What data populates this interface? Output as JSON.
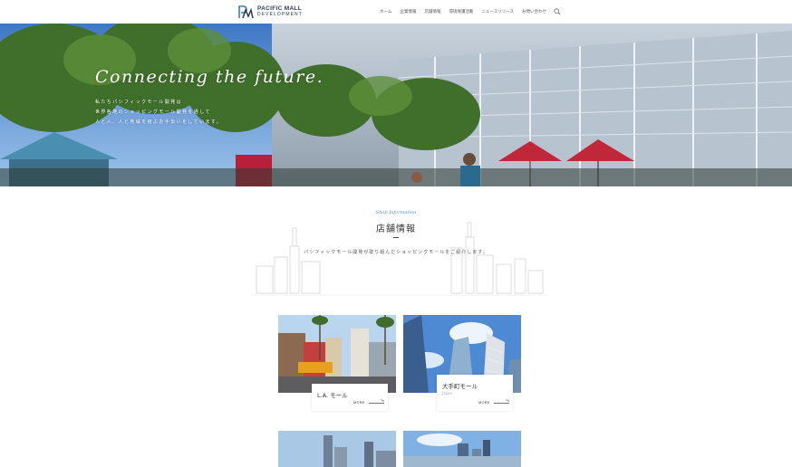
{
  "header": {
    "logo_line1": "PACIFIC MALL",
    "logo_line2": "DEVELOPMENT",
    "nav": [
      "ホーム",
      "企業情報",
      "店舗情報",
      "環境保護活動",
      "ニュースリリース",
      "お問い合わせ"
    ],
    "search_icon": "search-icon"
  },
  "hero": {
    "title": "Connecting the future.",
    "desc_lines": [
      "私たちパシフィックモール開発は",
      "世界各地のショッピングモール開発を通して",
      "人と人、人と地域を結ぶお手伝いをしています。"
    ]
  },
  "section": {
    "subtitle": "Shop Information",
    "title": "店舗情報",
    "desc": "パシフィックモール開発が取り組んだショッピングモールをご紹介します。"
  },
  "shops": [
    {
      "name": "L.A. モール",
      "sub": "",
      "more": "MORE"
    },
    {
      "name": "大手町モール",
      "sub": "Japan",
      "more": "MORE"
    }
  ],
  "colors": {
    "accent": "#4a90c8",
    "logo": "#2a3a5a"
  }
}
